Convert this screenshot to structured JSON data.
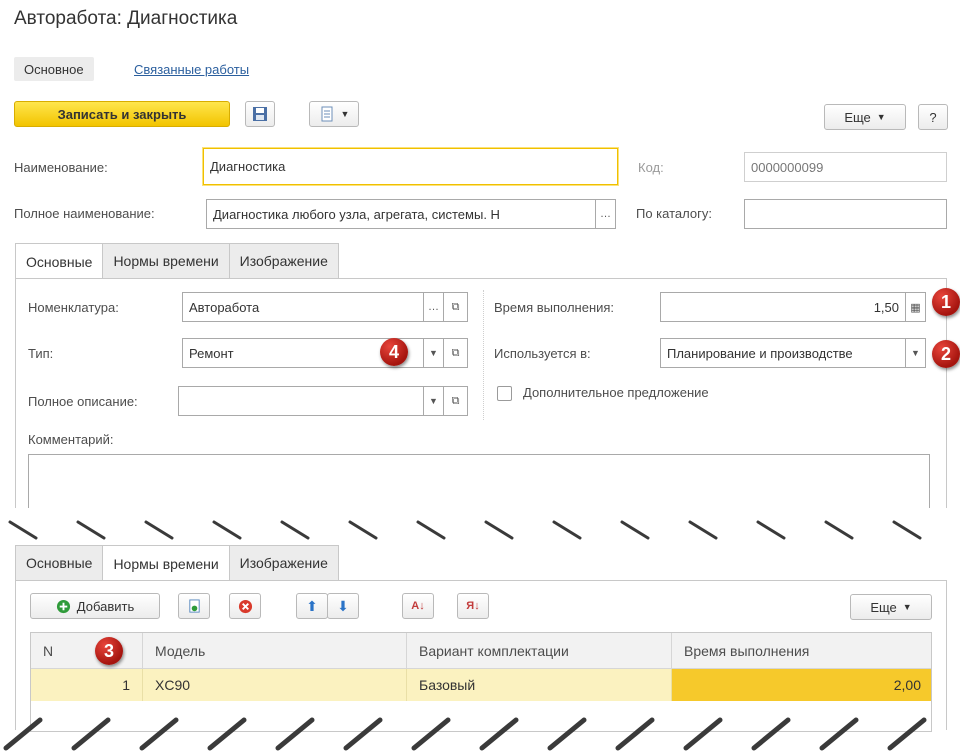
{
  "title": "Авторабота: Диагностика",
  "nav": {
    "main_tab": "Основное",
    "related_link": "Связанные работы"
  },
  "toolbar": {
    "save_close": "Записать и закрыть",
    "more": "Еще",
    "help": "?"
  },
  "fields": {
    "name_label": "Наименование:",
    "name_value": "Диагностика",
    "code_label": "Код:",
    "code_value": "0000000099",
    "fullname_label": "Полное наименование:",
    "fullname_value": "Диагностика любого узла, агрегата, системы. Н",
    "catalog_label": "По каталогу:",
    "catalog_value": ""
  },
  "tabs_top": [
    "Основные",
    "Нормы времени",
    "Изображение"
  ],
  "main_panel": {
    "nomenclature_label": "Номенклатура:",
    "nomenclature_value": "Авторабота",
    "type_label": "Тип:",
    "type_value": "Ремонт",
    "desc_label": "Полное описание:",
    "desc_value": "",
    "time_label": "Время выполнения:",
    "time_value": "1,50",
    "used_label": "Используется в:",
    "used_value": "Планирование и производстве",
    "extra_label": "Дополнительное предложение",
    "comment_label": "Комментарий:"
  },
  "tabs_bottom": [
    "Основные",
    "Нормы времени",
    "Изображение"
  ],
  "norms": {
    "add_label": "Добавить",
    "more": "Еще",
    "columns": [
      "N",
      "Модель",
      "Вариант комплектации",
      "Время выполнения"
    ],
    "rows": [
      {
        "n": "1",
        "model": "XC90",
        "variant": "Базовый",
        "time": "2,00"
      }
    ]
  },
  "markers": [
    "1",
    "2",
    "3",
    "4"
  ],
  "colors": {
    "accent_yellow": "#f2c400",
    "link_blue": "#2b5f9e",
    "marker_red": "#c0211a",
    "row_highlight": "#fbf2c0"
  }
}
